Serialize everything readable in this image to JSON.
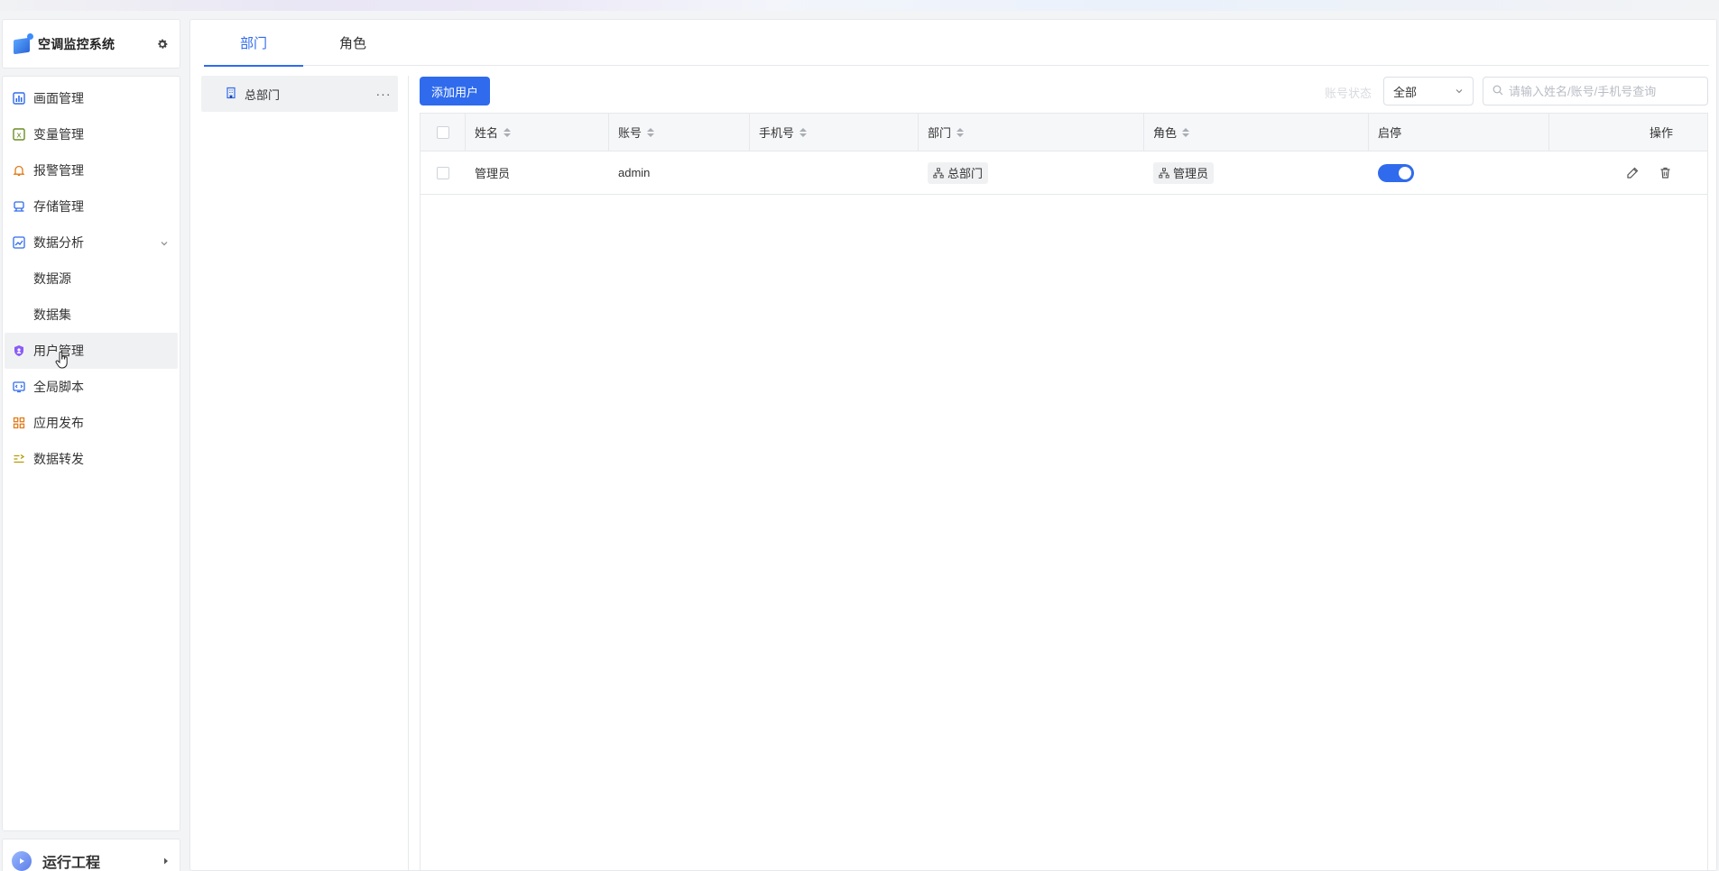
{
  "app": {
    "title": "空调监控系统"
  },
  "sidebar": {
    "items": [
      {
        "label": "画面管理",
        "icon": "screen-chart-icon"
      },
      {
        "label": "变量管理",
        "icon": "variable-icon"
      },
      {
        "label": "报警管理",
        "icon": "bell-icon"
      },
      {
        "label": "存储管理",
        "icon": "storage-icon"
      },
      {
        "label": "数据分析",
        "icon": "analysis-icon",
        "expanded": true
      },
      {
        "label": "数据源",
        "sub": true
      },
      {
        "label": "数据集",
        "sub": true
      },
      {
        "label": "用户管理",
        "icon": "user-shield-icon",
        "active": true
      },
      {
        "label": "全局脚本",
        "icon": "script-icon"
      },
      {
        "label": "应用发布",
        "icon": "apps-grid-icon"
      },
      {
        "label": "数据转发",
        "icon": "forward-icon"
      }
    ],
    "footer_label": "运行工程"
  },
  "tabs": [
    {
      "label": "部门",
      "active": true
    },
    {
      "label": "角色"
    }
  ],
  "dept_tree": {
    "root_label": "总部门",
    "more": "···"
  },
  "toolbar": {
    "add_user": "添加用户",
    "status_label": "账号状态",
    "status_value": "全部",
    "search_placeholder": "请输入姓名/账号/手机号查询"
  },
  "table": {
    "columns": [
      "姓名",
      "账号",
      "手机号",
      "部门",
      "角色",
      "启停",
      "操作"
    ],
    "rows": [
      {
        "name": "管理员",
        "account": "admin",
        "phone": "",
        "dept": "总部门",
        "role": "管理员",
        "enabled": true
      }
    ]
  },
  "colors": {
    "accent": "#2f6bec"
  }
}
